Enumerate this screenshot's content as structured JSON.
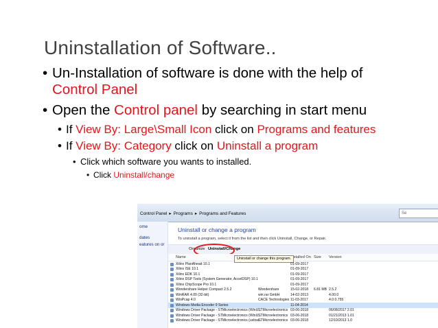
{
  "slide": {
    "title": "Uninstallation of Software..",
    "b1": "Un-Installation of software is done with the help of",
    "b1_red": "Control Panel",
    "b2_pre": "Open the ",
    "b2_red": "Control panel",
    "b2_post": " by searching in start menu",
    "b3_pre": "If ",
    "b3_red1": "View By: Large\\Small Icon",
    "b3_mid": " click on ",
    "b3_red2": "Programs and features",
    "b4_pre": "If ",
    "b4_red1": "View By: Category",
    "b4_mid": " click on ",
    "b4_red2": "Uninstall a program",
    "b5": "Click which software you wants to installed.",
    "b6_pre": "Click ",
    "b6_red": "Uninstall/change"
  },
  "screenshot": {
    "crumbs": [
      "Control Panel",
      "Programs",
      "Programs and Features"
    ],
    "search_placeholder": "Se",
    "left_pane": [
      "ome",
      "dates",
      "eatures on or"
    ],
    "title": "Uninstall or change a program",
    "desc": "To uninstall a program, select it from the list and then click Uninstall, Change, or Repair.",
    "organize": "Organize",
    "uninstall_change": "Uninstall/Change",
    "tooltip": "Uninstall or change this program.",
    "columns": [
      "Name",
      "er",
      "Installed On",
      "Size",
      "Version"
    ],
    "rows": [
      {
        "name": "Xilinx PlanAhead 10.1",
        "publisher": "",
        "date": "01-09-2017",
        "size": "",
        "version": ""
      },
      {
        "name": "Xilinx ISE 10.1",
        "publisher": "",
        "date": "01-09-2017",
        "size": "",
        "version": ""
      },
      {
        "name": "Xilinx EDK 10.1",
        "publisher": "",
        "date": "01-09-2017",
        "size": "",
        "version": ""
      },
      {
        "name": "Xilinx DSP Tools (System Generator, AccelDSP) 10.1",
        "publisher": "",
        "date": "01-09-2017",
        "size": "",
        "version": ""
      },
      {
        "name": "Xilinx ChipScope Pro 10.1",
        "publisher": "",
        "date": "01-09-2017",
        "size": "",
        "version": ""
      },
      {
        "name": "Wondershare Helper Compact 2.5.2",
        "publisher": "Wondershare",
        "date": "15-02-2018",
        "size": "6.81 MB",
        "version": "2.5.2"
      },
      {
        "name": "WinRAR 4.00 (32-bit)",
        "publisher": "win.rar GmbH",
        "date": "14-02-2013",
        "size": "",
        "version": "4.00.0"
      },
      {
        "name": "WinPcap 4.0",
        "publisher": "CACE Technologies",
        "date": "11-03-2017",
        "size": "",
        "version": "4.0.0.755"
      },
      {
        "name": "Windows Media Encoder 9 Series",
        "publisher": "",
        "date": "11-04-2014",
        "size": "",
        "version": ""
      },
      {
        "name": "Windows Driver Package - STMicroelectronics (WinU...",
        "publisher": "STMicroelectronics",
        "date": "03-06-2018",
        "size": "",
        "version": "06/08/2017 2.01"
      },
      {
        "name": "Windows Driver Package - STMicroelectronics (WinU...",
        "publisher": "STMicroelectronics",
        "date": "03-06-2018",
        "size": "",
        "version": "01/21/2013 1.01"
      },
      {
        "name": "Windows Driver Package - STMicroelectronics (usbse...",
        "publisher": "STMicroelectronics",
        "date": "03-06-2018",
        "size": "",
        "version": "12/10/2013 1.0"
      }
    ],
    "selected_row": 8
  }
}
